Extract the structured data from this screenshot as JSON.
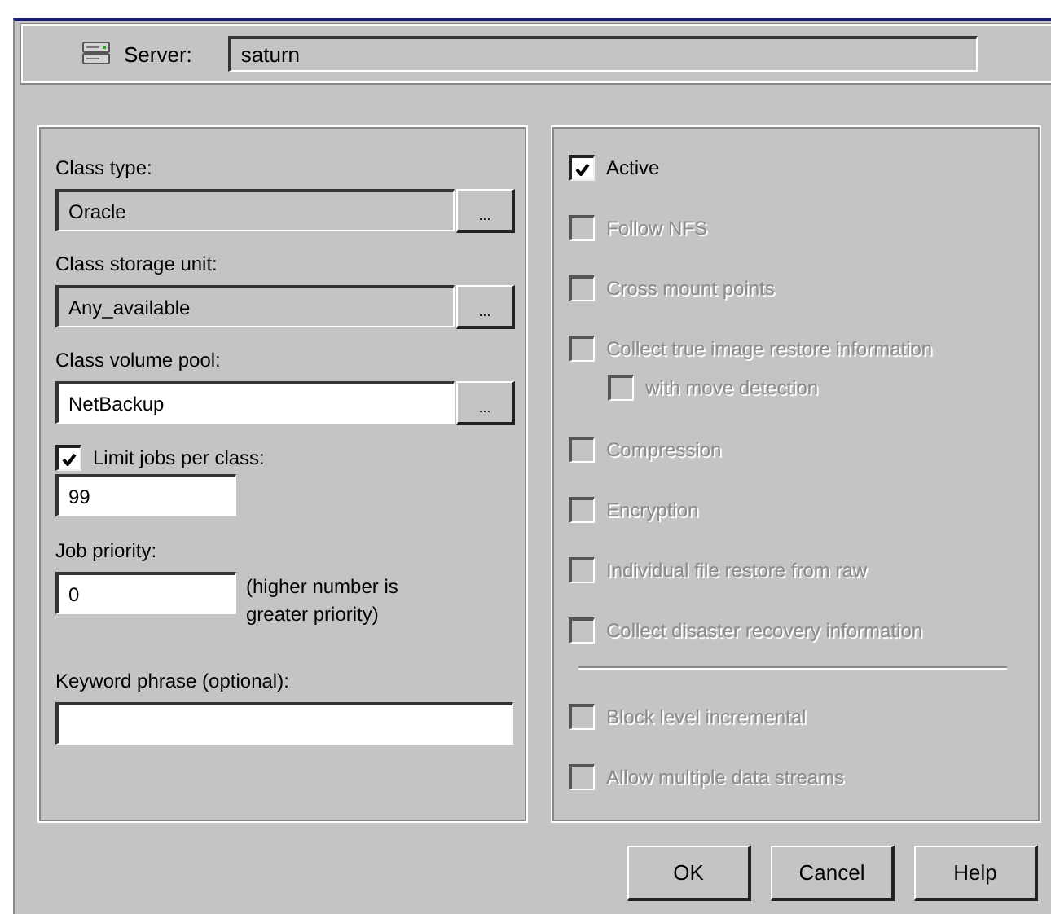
{
  "server": {
    "label": "Server:",
    "value": "saturn"
  },
  "fields": [
    {
      "kind": "browse",
      "label": "Class type:",
      "value": "Oracle",
      "disabled": true,
      "button": "..."
    },
    {
      "kind": "browse",
      "label": "Class storage unit:",
      "value": "Any_available",
      "disabled": true,
      "button": "..."
    },
    {
      "kind": "browse",
      "label": "Class volume pool:",
      "value": "NetBackup",
      "disabled": false,
      "button": "..."
    },
    {
      "kind": "checkbox-number",
      "label": "Limit jobs per class:",
      "checked": true,
      "value": "99"
    },
    {
      "kind": "number-note",
      "label": "Job priority:",
      "value": "0",
      "note": "(higher number is greater priority)"
    },
    {
      "kind": "text",
      "label": "Keyword phrase (optional):"
    }
  ],
  "options": [
    {
      "label": "Active",
      "checked": true,
      "disabled": false
    },
    {
      "label": "Follow NFS",
      "checked": false,
      "disabled": true
    },
    {
      "label": "Cross mount points",
      "checked": false,
      "disabled": true
    },
    {
      "label": "Collect true image restore information",
      "checked": false,
      "disabled": true,
      "children": [
        {
          "label": "with move detection",
          "checked": false,
          "disabled": true
        }
      ]
    },
    {
      "label": "Compression",
      "checked": false,
      "disabled": true
    },
    {
      "label": "Encryption",
      "checked": false,
      "disabled": true
    },
    {
      "label": "Individual file restore from raw",
      "checked": false,
      "disabled": true
    },
    {
      "label": "Collect disaster recovery information",
      "checked": false,
      "disabled": true
    }
  ],
  "more_options": [
    {
      "label": "Block level incremental",
      "checked": false,
      "disabled": true
    },
    {
      "label": "Allow multiple data streams",
      "checked": false,
      "disabled": true
    }
  ],
  "buttons": [
    "OK",
    "Cancel",
    "Help"
  ]
}
